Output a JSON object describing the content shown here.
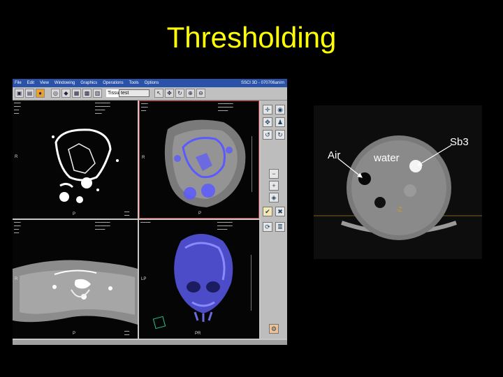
{
  "slide": {
    "title": "Thresholding"
  },
  "app": {
    "menu": [
      "File",
      "Edit",
      "View",
      "Windowing",
      "Graphics",
      "Operations",
      "Tools",
      "Options"
    ],
    "window_title": "SSCI 3D - 070706anirn",
    "tissue_label": "Tissue:",
    "tissue_value": "test"
  },
  "viewports": {
    "axial_top": {
      "orient_left": "R",
      "orient_bottom": "P"
    },
    "axial_overlay": {
      "orient_left": "R",
      "orient_bottom": "P"
    },
    "coronal": {
      "orient_left": "R",
      "orient_bottom": "P"
    },
    "render3d": {
      "orient_left": "LP",
      "orient_bottom": "PR"
    }
  },
  "phantom": {
    "labels": {
      "air": "Air",
      "water": "water",
      "sb3": "Sb3",
      "marker": "-Z"
    }
  },
  "colors": {
    "title": "#ffff00",
    "overlay": "#5a5aff",
    "render": "#4c4cc8"
  },
  "icons": [
    "save-icon",
    "open-icon",
    "lock-icon",
    "zoom-icon",
    "pan-icon",
    "rotate-icon",
    "checkmark-icon",
    "close-icon"
  ]
}
